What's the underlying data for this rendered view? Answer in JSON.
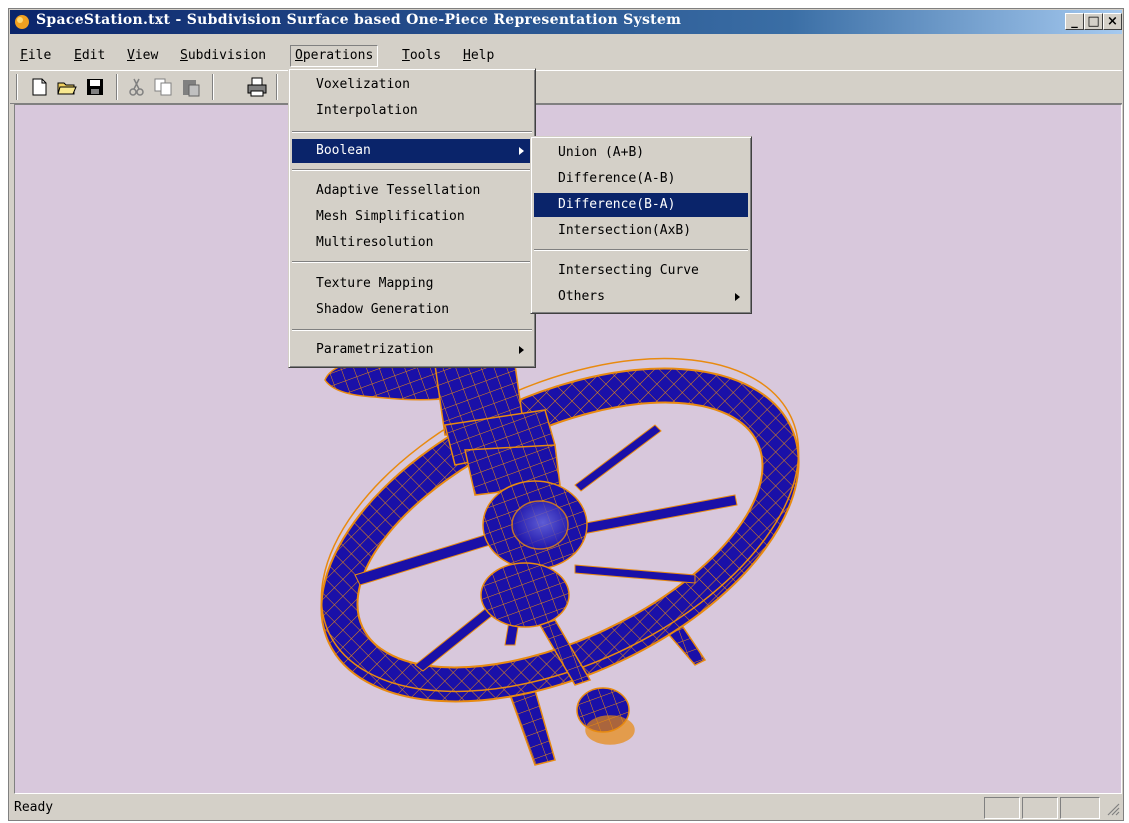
{
  "window": {
    "title": "SpaceStation.txt - Subdivision Surface based One-Piece Representation System",
    "minimize_glyph": "_",
    "maximize_glyph": "□",
    "close_glyph": "×"
  },
  "menubar": [
    {
      "label": "File",
      "hotkey": "F"
    },
    {
      "label": "Edit",
      "hotkey": "E"
    },
    {
      "label": "View",
      "hotkey": "V"
    },
    {
      "label": "Subdivision",
      "hotkey": "S"
    },
    {
      "label": "Operations",
      "hotkey": "O"
    },
    {
      "label": "Tools",
      "hotkey": "T"
    },
    {
      "label": "Help",
      "hotkey": "H"
    }
  ],
  "toolbar": {
    "buttons": [
      "new-file-icon",
      "open-folder-icon",
      "save-icon",
      "cut-icon",
      "copy-icon",
      "paste-icon",
      "print-icon"
    ]
  },
  "operations_menu": {
    "items": [
      {
        "label": "Voxelization",
        "hotkey": "V"
      },
      {
        "label": "Interpolation",
        "hotkey": "I"
      },
      {
        "label": "Boolean",
        "hotkey": "B",
        "submenu": true,
        "highlighted": true
      },
      {
        "label": "Adaptive Tessellation",
        "hotkey": "A"
      },
      {
        "label": "Mesh Simplification",
        "hotkey": "S"
      },
      {
        "label": "Multiresolution",
        "hotkey": "M"
      },
      {
        "label": "Texture Mapping",
        "hotkey": "T"
      },
      {
        "label": "Shadow Generation",
        "hotkey": "S"
      },
      {
        "label": "Parametrization",
        "hotkey": "P",
        "submenu": true
      }
    ]
  },
  "boolean_submenu": {
    "items": [
      {
        "label": "Union (A+B)",
        "hotkey": "U"
      },
      {
        "label": "Difference(A-B)",
        "hotkey": "A"
      },
      {
        "label": "Difference(B-A)",
        "hotkey": "B",
        "highlighted": true
      },
      {
        "label": "Intersection(AxB)",
        "hotkey": "I"
      },
      {
        "label": "Intersecting Curve",
        "hotkey": "C"
      },
      {
        "label": "Others",
        "hotkey": "O",
        "submenu": true
      }
    ]
  },
  "status": {
    "text": "Ready"
  },
  "colors": {
    "viewport_bg": "#d8c8dc",
    "mesh_fill": "#1a10a8",
    "mesh_edges": "#e88a10",
    "menu_highlight": "#0a246a"
  }
}
